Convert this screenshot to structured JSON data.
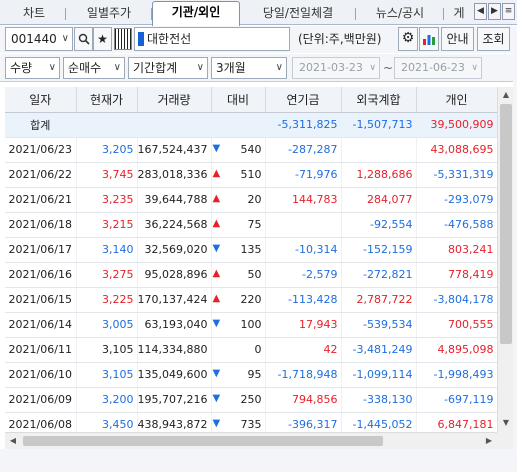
{
  "tabs": [
    {
      "label": "차트"
    },
    {
      "label": "일별주가"
    },
    {
      "label": "기관/외인"
    },
    {
      "label": "당일/전일체결"
    },
    {
      "label": "뉴스/공시"
    },
    {
      "label": "게"
    }
  ],
  "tab_nav": {
    "prev": "◀",
    "next": "▶",
    "menu": "≡"
  },
  "toolbar": {
    "code": "001440",
    "code_dropdown": "∨",
    "search_icon": "🔍",
    "star_icon": "★",
    "stock_name": "대한전선",
    "unit": "(단위:주,백만원)",
    "gear_icon": "⚙",
    "chart_icon": "📊",
    "guide_label": "안내",
    "query_label": "조회"
  },
  "filters": {
    "qty": "수량",
    "net": "순매수",
    "period_sum": "기간합계",
    "range": "3개월",
    "dropdown": "∨",
    "date_from": "2021-03-23",
    "date_to": "2021-06-23",
    "tilde": "~"
  },
  "table": {
    "headers": [
      "일자",
      "현재가",
      "거래량",
      "대비",
      "연기금",
      "외국계합",
      "개인"
    ],
    "summary": {
      "label": "합계",
      "pension": "-5,311,825",
      "foreign": "-1,507,713",
      "individual": "39,500,909"
    },
    "rows": [
      {
        "date": "2021/06/23",
        "price": "3,205",
        "price_dir": "down",
        "volume": "167,524,437",
        "arrow": "▼",
        "chg_dir": "down",
        "change": "540",
        "pension": "-287,287",
        "foreign": "",
        "individual": "43,088,695"
      },
      {
        "date": "2021/06/22",
        "price": "3,745",
        "price_dir": "up",
        "volume": "283,018,336",
        "arrow": "▲",
        "chg_dir": "up",
        "change": "510",
        "pension": "-71,976",
        "foreign": "1,288,686",
        "individual": "-5,331,319"
      },
      {
        "date": "2021/06/21",
        "price": "3,235",
        "price_dir": "up",
        "volume": "39,644,788",
        "arrow": "▲",
        "chg_dir": "up",
        "change": "20",
        "pension": "144,783",
        "foreign": "284,077",
        "individual": "-293,079"
      },
      {
        "date": "2021/06/18",
        "price": "3,215",
        "price_dir": "up",
        "volume": "36,224,568",
        "arrow": "▲",
        "chg_dir": "up",
        "change": "75",
        "pension": "",
        "foreign": "-92,554",
        "individual": "-476,588"
      },
      {
        "date": "2021/06/17",
        "price": "3,140",
        "price_dir": "down",
        "volume": "32,569,020",
        "arrow": "▼",
        "chg_dir": "down",
        "change": "135",
        "pension": "-10,314",
        "foreign": "-152,159",
        "individual": "803,241"
      },
      {
        "date": "2021/06/16",
        "price": "3,275",
        "price_dir": "up",
        "volume": "95,028,896",
        "arrow": "▲",
        "chg_dir": "up",
        "change": "50",
        "pension": "-2,579",
        "foreign": "-272,821",
        "individual": "778,419"
      },
      {
        "date": "2021/06/15",
        "price": "3,225",
        "price_dir": "up",
        "volume": "170,137,424",
        "arrow": "▲",
        "chg_dir": "up",
        "change": "220",
        "pension": "-113,428",
        "foreign": "2,787,722",
        "individual": "-3,804,178"
      },
      {
        "date": "2021/06/14",
        "price": "3,005",
        "price_dir": "down",
        "volume": "63,193,040",
        "arrow": "▼",
        "chg_dir": "down",
        "change": "100",
        "pension": "17,943",
        "foreign": "-539,534",
        "individual": "700,555"
      },
      {
        "date": "2021/06/11",
        "price": "3,105",
        "price_dir": "flat",
        "volume": "114,334,880",
        "arrow": "",
        "chg_dir": "flat",
        "change": "0",
        "pension": "42",
        "foreign": "-3,481,249",
        "individual": "4,895,098"
      },
      {
        "date": "2021/06/10",
        "price": "3,105",
        "price_dir": "down",
        "volume": "135,049,600",
        "arrow": "▼",
        "chg_dir": "down",
        "change": "95",
        "pension": "-1,718,948",
        "foreign": "-1,099,114",
        "individual": "-1,998,493"
      },
      {
        "date": "2021/06/09",
        "price": "3,200",
        "price_dir": "down",
        "volume": "195,707,216",
        "arrow": "▼",
        "chg_dir": "down",
        "change": "250",
        "pension": "794,856",
        "foreign": "-338,130",
        "individual": "-697,119"
      },
      {
        "date": "2021/06/08",
        "price": "3,450",
        "price_dir": "down",
        "volume": "438,943,872",
        "arrow": "▼",
        "chg_dir": "down",
        "change": "735",
        "pension": "-396,317",
        "foreign": "-1,445,052",
        "individual": "6,847,181"
      }
    ]
  },
  "scroll_glyphs": {
    "up": "▲",
    "down": "▼",
    "left": "◀",
    "right": "▶"
  }
}
